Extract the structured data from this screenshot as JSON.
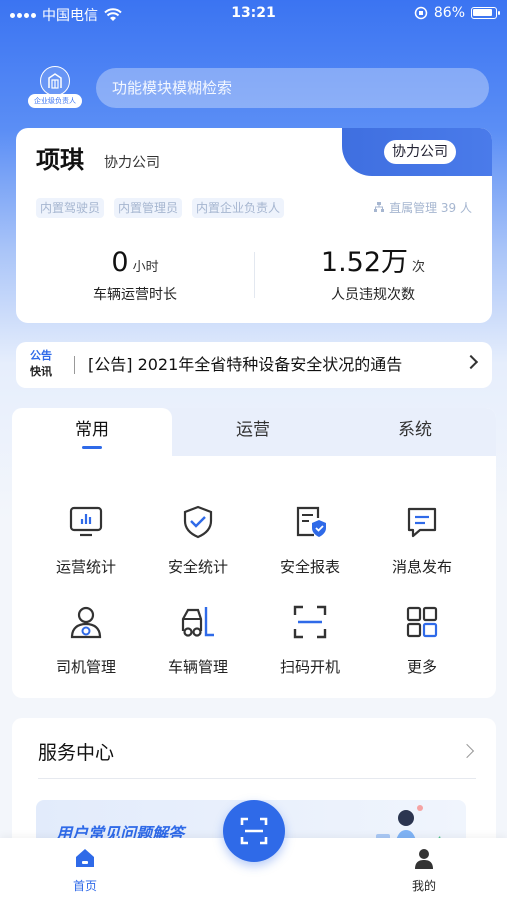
{
  "status_bar": {
    "carrier": "中国电信",
    "time": "13:21",
    "battery": "86%"
  },
  "header": {
    "role_tag": "企业级负责人",
    "search_placeholder": "功能模块模糊检索"
  },
  "profile": {
    "name": "项琪",
    "company": "协力公司",
    "company_pill": "协力公司",
    "roles": [
      "内置驾驶员",
      "内置管理员",
      "内置企业负责人"
    ],
    "direct_manage": "直属管理 39 人"
  },
  "stats": [
    {
      "value": "0",
      "unit": "小时",
      "label": "车辆运营时长"
    },
    {
      "value": "1.52万",
      "unit": "次",
      "label": "人员违规次数"
    }
  ],
  "notice": {
    "tag_line1": "公告",
    "tag_line2": "快讯",
    "text": "[公告] 2021年全省特种设备安全状况的通告"
  },
  "tabs": [
    "常用",
    "运营",
    "系统"
  ],
  "functions": [
    {
      "label": "运营统计",
      "icon": "chart-board-icon"
    },
    {
      "label": "安全统计",
      "icon": "shield-check-icon"
    },
    {
      "label": "安全报表",
      "icon": "report-shield-icon"
    },
    {
      "label": "消息发布",
      "icon": "message-icon"
    },
    {
      "label": "司机管理",
      "icon": "driver-icon"
    },
    {
      "label": "车辆管理",
      "icon": "forklift-icon"
    },
    {
      "label": "扫码开机",
      "icon": "scan-icon"
    },
    {
      "label": "更多",
      "icon": "grid-more-icon"
    }
  ],
  "service": {
    "title": "服务中心",
    "faq_banner": "用户常见问题解答"
  },
  "bottom_nav": {
    "home": "首页",
    "mine": "我的"
  },
  "colors": {
    "primary": "#2f6ae8",
    "hero_top": "#3b74f2"
  }
}
